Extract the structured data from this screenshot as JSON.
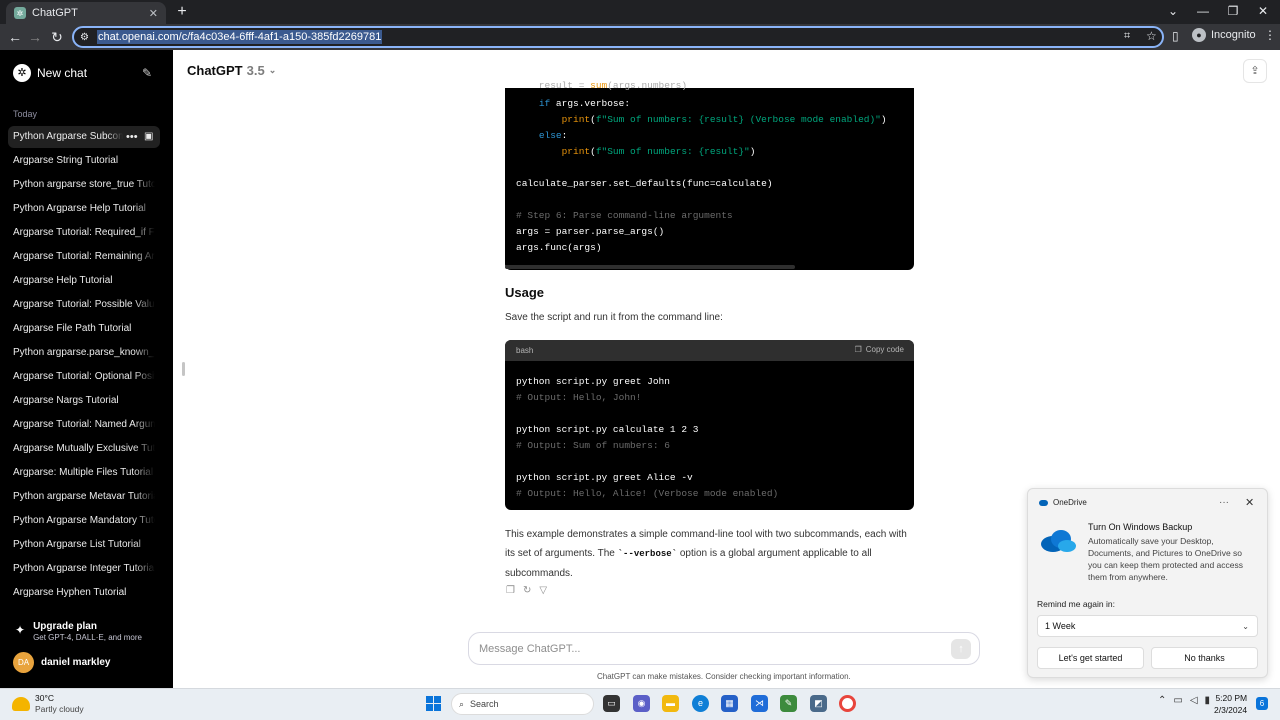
{
  "browser": {
    "tab_title": "ChatGPT",
    "tab_close": "✕",
    "new_tab": "+",
    "url": "chat.openai.com/c/fa4c03e4-6fff-4af1-a150-385fd2269781",
    "profile": "Incognito"
  },
  "sidebar": {
    "new_chat": "New chat",
    "section_label": "Today",
    "items": [
      "Python Argparse Subcommands",
      "Argparse String Tutorial",
      "Python argparse store_true Tutorial",
      "Python Argparse Help Tutorial",
      "Argparse Tutorial: Required_if Feature",
      "Argparse Tutorial: Remaining Args",
      "Argparse Help Tutorial",
      "Argparse Tutorial: Possible Values",
      "Argparse File Path Tutorial",
      "Python argparse.parse_known_args",
      "Argparse Tutorial: Optional Positional",
      "Argparse Nargs Tutorial",
      "Argparse Tutorial: Named Arguments",
      "Argparse Mutually Exclusive Tutorial",
      "Argparse: Multiple Files Tutorial",
      "Python argparse Metavar Tutorial",
      "Python Argparse Mandatory Tutorial",
      "Python Argparse List Tutorial",
      "Python Argparse Integer Tutorial",
      "Argparse Hyphen Tutorial"
    ],
    "upgrade_title": "Upgrade plan",
    "upgrade_sub": "Get GPT-4, DALL·E, and more",
    "user_initials": "DA",
    "user_name": "daniel markley"
  },
  "header": {
    "model": "ChatGPT",
    "version": "3.5"
  },
  "content": {
    "usage_heading": "Usage",
    "usage_text": "Save the script and run it from the command line:",
    "code2_lang": "bash",
    "copy_label": "Copy code",
    "summary_a": "This example demonstrates a simple command-line tool with two subcommands, each with its set of arguments. The ",
    "summary_code": "`--verbose`",
    "summary_b": " option is a global argument applicable to all subcommands."
  },
  "composer": {
    "placeholder": "Message ChatGPT...",
    "disclaimer": "ChatGPT can make mistakes. Consider checking important information."
  },
  "onedrive": {
    "app": "OneDrive",
    "title": "Turn On Windows Backup",
    "body": "Automatically save your Desktop, Documents, and Pictures to OneDrive so you can keep them protected and access them from anywhere.",
    "remind_label": "Remind me again in:",
    "remind_value": "1 Week",
    "primary": "Let's get started",
    "secondary": "No thanks"
  },
  "taskbar": {
    "temp": "30°C",
    "condition": "Partly cloudy",
    "search": "Search",
    "time": "5:20 PM",
    "date": "2/3/2024",
    "notif_count": "6"
  },
  "colors": {
    "accent": "#0a74da",
    "sidebar": "#000000",
    "code_bg": "#000000"
  }
}
